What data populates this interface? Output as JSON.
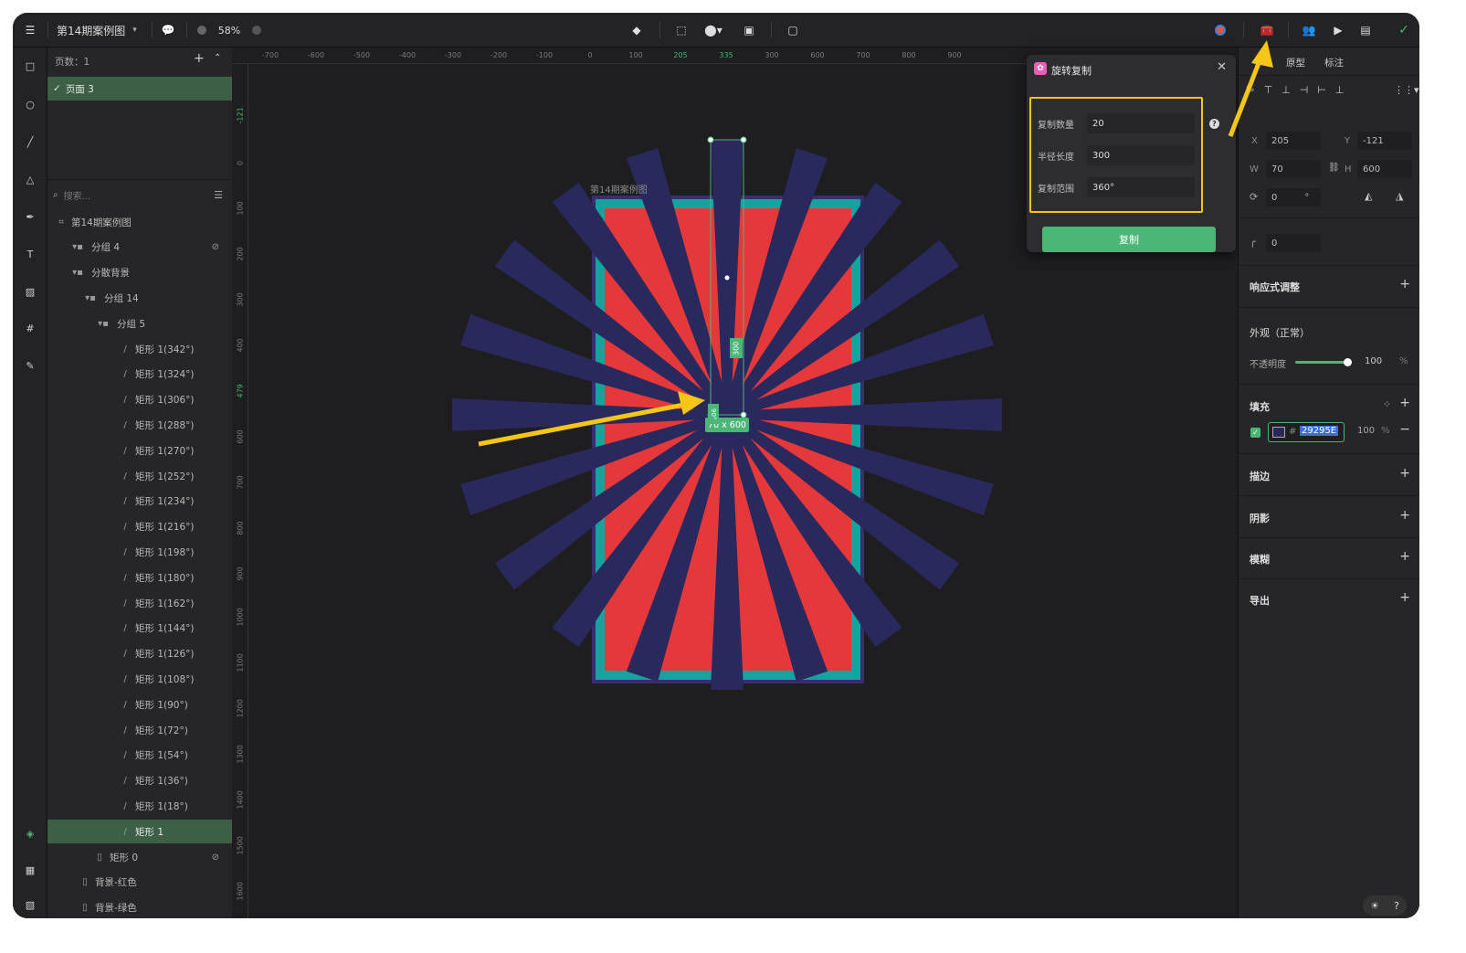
{
  "topbar": {
    "file_name": "第14期案例图",
    "zoom": "58%"
  },
  "layers": {
    "pages_label": "页数：1",
    "page_item": "页面 3",
    "search_placeholder": "搜索...",
    "tree": [
      {
        "label": "第14期案例图",
        "icon": "frame-icon"
      },
      {
        "label": "分组 4",
        "icon": "folder-icon"
      },
      {
        "label": "分散背景",
        "icon": "folder-icon"
      },
      {
        "label": "分组 14",
        "icon": "folder-icon"
      },
      {
        "label": "分组 5",
        "icon": "folder-icon"
      },
      {
        "label": "矩形 1(342°)"
      },
      {
        "label": "矩形 1(324°)"
      },
      {
        "label": "矩形 1(306°)"
      },
      {
        "label": "矩形 1(288°)"
      },
      {
        "label": "矩形 1(270°)"
      },
      {
        "label": "矩形 1(252°)"
      },
      {
        "label": "矩形 1(234°)"
      },
      {
        "label": "矩形 1(216°)"
      },
      {
        "label": "矩形 1(198°)"
      },
      {
        "label": "矩形 1(180°)"
      },
      {
        "label": "矩形 1(162°)"
      },
      {
        "label": "矩形 1(144°)"
      },
      {
        "label": "矩形 1(126°)"
      },
      {
        "label": "矩形 1(108°)"
      },
      {
        "label": "矩形 1(90°)"
      },
      {
        "label": "矩形 1(72°)"
      },
      {
        "label": "矩形 1(54°)"
      },
      {
        "label": "矩形 1(36°)"
      },
      {
        "label": "矩形 1(18°)"
      },
      {
        "label": "矩形 1"
      },
      {
        "label": "矩形 0"
      },
      {
        "label": "背景-红色"
      },
      {
        "label": "背景-绿色"
      }
    ]
  },
  "ruler": {
    "top": [
      "-700",
      "-600",
      "-500",
      "-400",
      "-300",
      "-200",
      "-100",
      "0",
      "100",
      "205",
      "335",
      "300",
      "600",
      "700",
      "800",
      "900"
    ],
    "left": [
      "-121",
      "0",
      "100",
      "200",
      "300",
      "400",
      "479",
      "600",
      "700",
      "800",
      "900",
      "1000",
      "1100",
      "1200",
      "1300",
      "1400",
      "1500",
      "1600"
    ]
  },
  "canvas": {
    "artboard_label": "第14期案例图",
    "dim_label": "70 x 600",
    "height_tag": "300",
    "angle_tag": "90°",
    "colors": {
      "red": "#e5383b",
      "teal": "#15a3a0",
      "navy": "#29295e",
      "border": "#3a2c6e",
      "accent": "#4ab776",
      "arrow": "#f5c518"
    }
  },
  "dialog": {
    "title": "旋转复制",
    "count_label": "复制数量",
    "count_value": "20",
    "radius_label": "半径长度",
    "radius_value": "300",
    "range_label": "复制范围",
    "range_value": "360°",
    "copy_button": "复制"
  },
  "rpanel": {
    "tab_prototype": "原型",
    "tab_annotate": "标注",
    "x_label": "X",
    "x_value": "205",
    "y_label": "Y",
    "y_value": "-121",
    "w_label": "W",
    "w_value": "70",
    "h_label": "H",
    "h_value": "600",
    "rotation_value": "0",
    "rotation_unit": "°",
    "radius_value": "0",
    "responsive": "响应式调整",
    "appearance": "外观（正常）",
    "opacity_label": "不透明度",
    "opacity_value": "100",
    "opacity_unit": "%",
    "opacity_level": 1.0,
    "fill": "填充",
    "fill_hash": "#",
    "fill_hex": "29295E",
    "fill_opacity": "100",
    "fill_unit": "%",
    "stroke": "描边",
    "shadow": "阴影",
    "blur": "模糊",
    "export": "导出"
  }
}
